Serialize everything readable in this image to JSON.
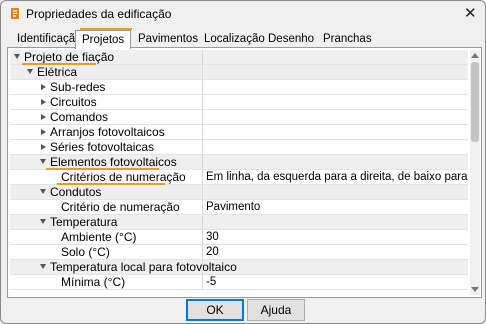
{
  "window": {
    "title": "Propriedades da edificação",
    "close": "✕",
    "accent": "#f39c12"
  },
  "tabs": [
    {
      "label": "Identificação"
    },
    {
      "label": "Projetos",
      "active": true
    },
    {
      "label": "Pavimentos"
    },
    {
      "label": "Localização"
    },
    {
      "label": "Desenho"
    },
    {
      "label": "Pranchas"
    }
  ],
  "tree": [
    {
      "label": "Projeto de fiação",
      "value": "",
      "expander": "down"
    },
    {
      "label": "Elétrica",
      "value": "",
      "expander": "down"
    },
    {
      "label": "Sub-redes",
      "value": "",
      "expander": "right"
    },
    {
      "label": "Circuitos",
      "value": "",
      "expander": "right"
    },
    {
      "label": "Comandos",
      "value": "",
      "expander": "right"
    },
    {
      "label": "Arranjos fotovoltaicos",
      "value": "",
      "expander": "right"
    },
    {
      "label": "Séries fotovoltaicas",
      "value": "",
      "expander": "right"
    },
    {
      "label": "Elementos fotovoltaicos",
      "value": "",
      "expander": "down"
    },
    {
      "label": "Critérios de numeração",
      "value": "Em linha, da esquerda para a direita, de baixo para cima",
      "expander": ""
    },
    {
      "label": "Condutos",
      "value": "",
      "expander": "down"
    },
    {
      "label": "Critério de numeração",
      "value": "Pavimento",
      "expander": ""
    },
    {
      "label": "Temperatura",
      "value": "",
      "expander": "down"
    },
    {
      "label": "Ambiente (°C)",
      "value": "30",
      "expander": ""
    },
    {
      "label": "Solo (°C)",
      "value": "20",
      "expander": ""
    },
    {
      "label": "Temperatura local para fotovoltaico",
      "value": "",
      "expander": "down"
    },
    {
      "label": "Mínima (°C)",
      "value": "-5",
      "expander": ""
    }
  ],
  "buttons": {
    "ok": "OK",
    "help": "Ajuda"
  }
}
